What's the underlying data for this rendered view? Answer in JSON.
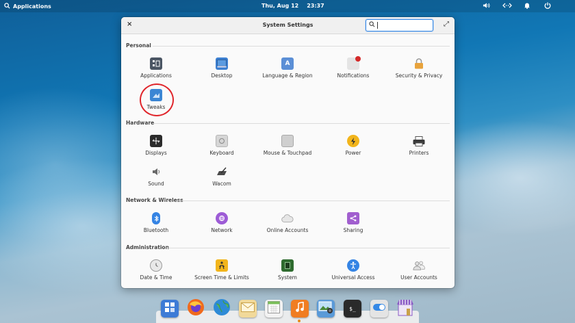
{
  "panel": {
    "applications_label": "Applications",
    "date": "Thu, Aug 12",
    "time": "23:37",
    "indicators": [
      "volume-icon",
      "network-icon",
      "notifications-icon",
      "power-icon"
    ]
  },
  "window": {
    "title": "System Settings",
    "close_symbol": "×",
    "maximize_symbol": "⤢",
    "search": {
      "value": "",
      "placeholder": ""
    }
  },
  "sections": {
    "personal": {
      "title": "Personal",
      "items": [
        {
          "label": "Applications",
          "icon": "applications-icon",
          "color": "#4a5563"
        },
        {
          "label": "Desktop",
          "icon": "desktop-icon",
          "color": "#3c7fd1"
        },
        {
          "label": "Language & Region",
          "icon": "language-region-icon",
          "color": "#5b8fd6"
        },
        {
          "label": "Notifications",
          "icon": "notifications-icon",
          "color": "#d9d9d9"
        },
        {
          "label": "Security & Privacy",
          "icon": "lock-icon",
          "color": "#e8a33c"
        },
        {
          "label": "Tweaks",
          "icon": "tweaks-icon",
          "color": "#3b86d4"
        }
      ]
    },
    "hardware": {
      "title": "Hardware",
      "items": [
        {
          "label": "Displays",
          "icon": "displays-icon",
          "color": "#2b2b2b"
        },
        {
          "label": "Keyboard",
          "icon": "keyboard-icon",
          "color": "#d6d6d6"
        },
        {
          "label": "Mouse & Touchpad",
          "icon": "mouse-icon",
          "color": "#cfcfcf"
        },
        {
          "label": "Power",
          "icon": "power-icon",
          "color": "#f2b51c"
        },
        {
          "label": "Printers",
          "icon": "printer-icon",
          "color": "#3a3a3a"
        },
        {
          "label": "Sound",
          "icon": "speaker-icon",
          "color": "#8a8a8a"
        },
        {
          "label": "Wacom",
          "icon": "wacom-icon",
          "color": "#555555"
        }
      ]
    },
    "network": {
      "title": "Network & Wireless",
      "items": [
        {
          "label": "Bluetooth",
          "icon": "bluetooth-icon",
          "color": "#3584e4"
        },
        {
          "label": "Network",
          "icon": "network-icon",
          "color": "#9d5cd6"
        },
        {
          "label": "Online Accounts",
          "icon": "cloud-icon",
          "color": "#dcdcdc"
        },
        {
          "label": "Sharing",
          "icon": "share-icon",
          "color": "#a15fcf"
        }
      ]
    },
    "administration": {
      "title": "Administration",
      "items": [
        {
          "label": "Date & Time",
          "icon": "clock-icon",
          "color": "#c9c9c9"
        },
        {
          "label": "Screen Time & Limits",
          "icon": "screen-time-icon",
          "color": "#f2b51c"
        },
        {
          "label": "System",
          "icon": "system-icon",
          "color": "#2f6b2f"
        },
        {
          "label": "Universal Access",
          "icon": "accessibility-icon",
          "color": "#3584e4"
        },
        {
          "label": "User Accounts",
          "icon": "users-icon",
          "color": "#cfcfcf"
        }
      ]
    }
  },
  "dock": {
    "items": [
      {
        "name": "multitasking-view",
        "color": "#3d7bd6"
      },
      {
        "name": "firefox",
        "color": "#f06a1d"
      },
      {
        "name": "web-browser",
        "color": "#2e8bd6"
      },
      {
        "name": "mail",
        "color": "#e9c46a"
      },
      {
        "name": "calendar",
        "color": "#e8e8e8"
      },
      {
        "name": "music",
        "color": "#f07d22"
      },
      {
        "name": "photos",
        "color": "#5a9ad8"
      },
      {
        "name": "terminal",
        "color": "#2a2a2a"
      },
      {
        "name": "system-settings",
        "color": "#dcdcdc"
      },
      {
        "name": "appcenter",
        "color": "#8a5ac4"
      }
    ]
  }
}
